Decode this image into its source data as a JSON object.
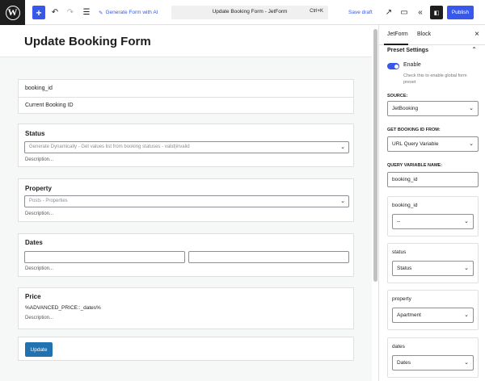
{
  "toolbar": {
    "generate_label": "Generate Form with AI",
    "doc_title": "Update Booking Form - JetForm",
    "shortcut": "Ctrl+K",
    "save_draft": "Save draft",
    "publish": "Publish"
  },
  "editor": {
    "page_title": "Update Booking Form",
    "booking_field": {
      "name": "booking_id",
      "value": "Current Booking ID"
    },
    "status_field": {
      "label": "Status",
      "placeholder": "Generate Dynamically - Get values list from booking statuses - valid|invalid",
      "description": "Description..."
    },
    "property_field": {
      "label": "Property",
      "placeholder": "Posts - Properties",
      "description": "Description..."
    },
    "dates_field": {
      "label": "Dates",
      "description": "Description..."
    },
    "price_field": {
      "label": "Price",
      "formula": "%ADVANCED_PRICE::_dates%",
      "description": "Description..."
    },
    "submit_label": "Update"
  },
  "sidebar": {
    "tabs": [
      "JetForm",
      "Block"
    ],
    "section_title": "Preset Settings",
    "enable_label": "Enable",
    "enable_help": "Check this to enable global form preset",
    "source_label": "SOURCE:",
    "source_value": "JetBooking",
    "get_from_label": "GET BOOKING ID FROM:",
    "get_from_value": "URL Query Variable",
    "query_label": "QUERY VARIABLE NAME:",
    "query_value": "booking_id",
    "mappings": [
      {
        "field": "booking_id",
        "value": "--"
      },
      {
        "field": "status",
        "value": "Status"
      },
      {
        "field": "property",
        "value": "Apartment"
      },
      {
        "field": "dates",
        "value": "Dates"
      }
    ]
  }
}
